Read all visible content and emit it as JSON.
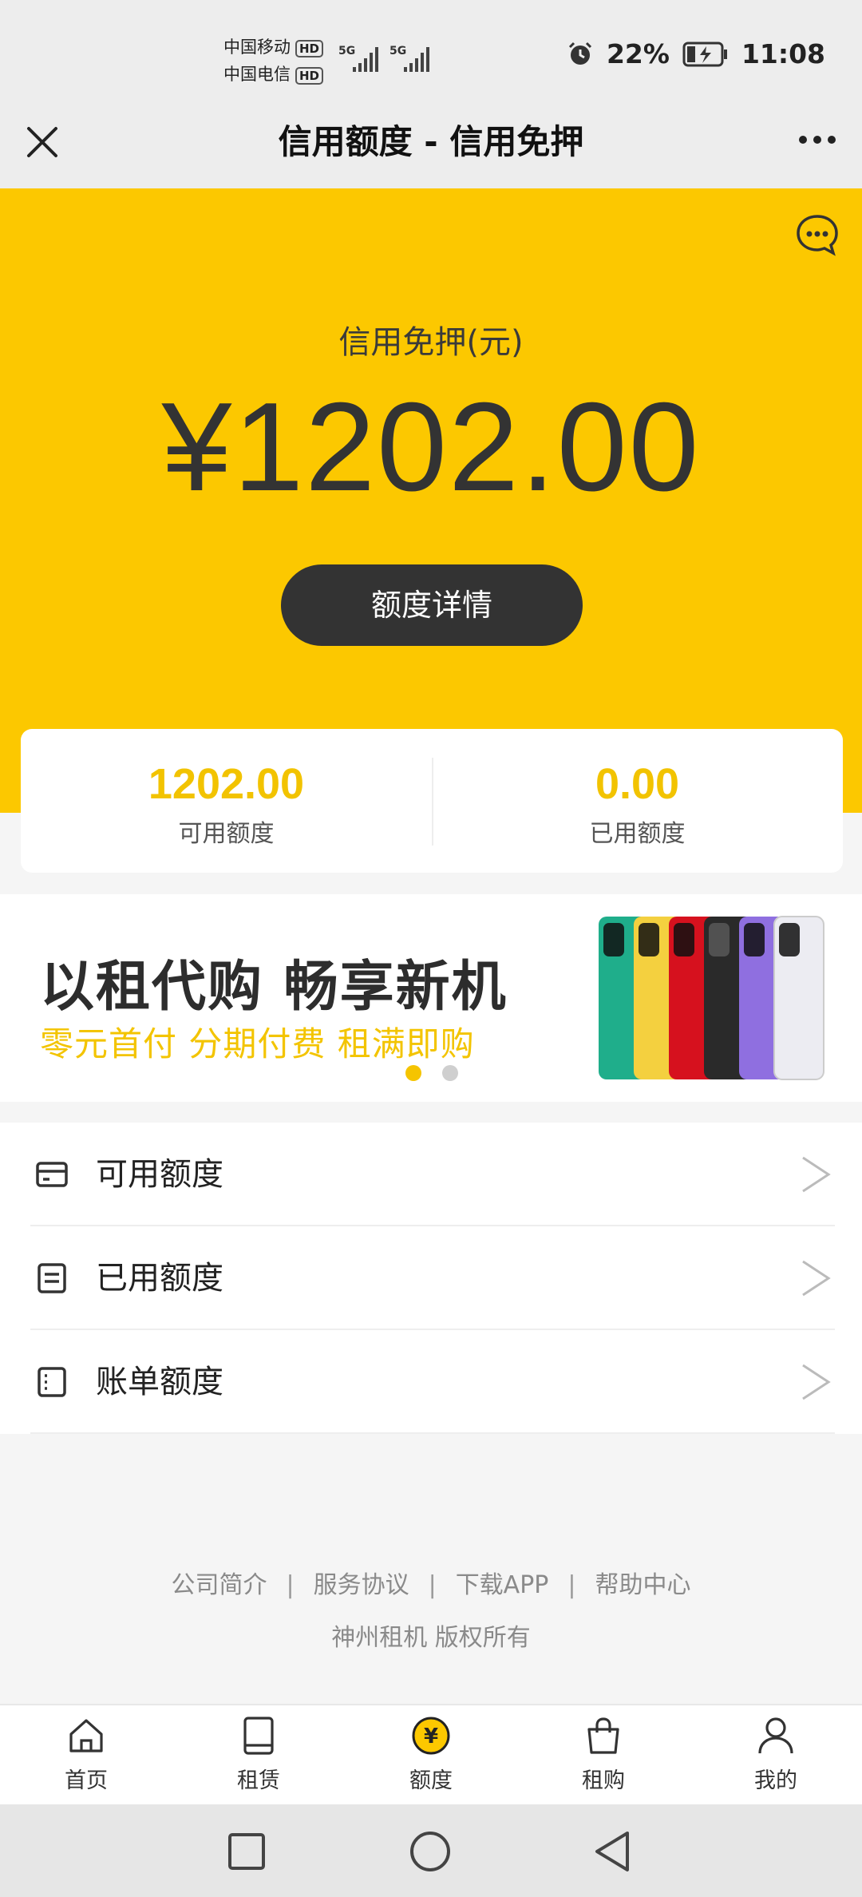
{
  "status_bar": {
    "carrier1": "中国移动",
    "carrier2": "中国电信",
    "hd": "HD",
    "net1": "5G",
    "net2": "5G",
    "battery": "22%",
    "time": "11:08"
  },
  "header": {
    "title": "信用额度 - 信用免押",
    "close_icon": "close-icon",
    "more_icon": "more-icon"
  },
  "hero": {
    "label": "信用免押(元)",
    "amount": "¥1202.00",
    "button": "额度详情",
    "bg_color": "#fcc800"
  },
  "summary": {
    "available_value": "1202.00",
    "available_label": "可用额度",
    "used_value": "0.00",
    "used_label": "已用额度"
  },
  "banner": {
    "title": "以租代购 畅享新机",
    "subtitle": "零元首付 分期付费 租满即购",
    "active_slide": 1,
    "slides": 2
  },
  "menu": {
    "items": [
      {
        "label": "可用额度",
        "icon": "card-icon"
      },
      {
        "label": "已用额度",
        "icon": "document-icon"
      },
      {
        "label": "账单额度",
        "icon": "bill-icon"
      }
    ]
  },
  "footer": {
    "links": [
      "公司简介",
      "服务协议",
      "下载APP",
      "帮助中心"
    ],
    "separator": "|",
    "copyright": "神州租机 版权所有"
  },
  "tabs": [
    {
      "label": "首页",
      "icon": "home-icon"
    },
    {
      "label": "租赁",
      "icon": "tablet-icon"
    },
    {
      "label": "额度",
      "icon": "yen-icon"
    },
    {
      "label": "租购",
      "icon": "bag-icon"
    },
    {
      "label": "我的",
      "icon": "user-icon"
    }
  ],
  "colors": {
    "accent": "#fcc800",
    "amount_yellow": "#f2c300",
    "dark": "#333333"
  }
}
